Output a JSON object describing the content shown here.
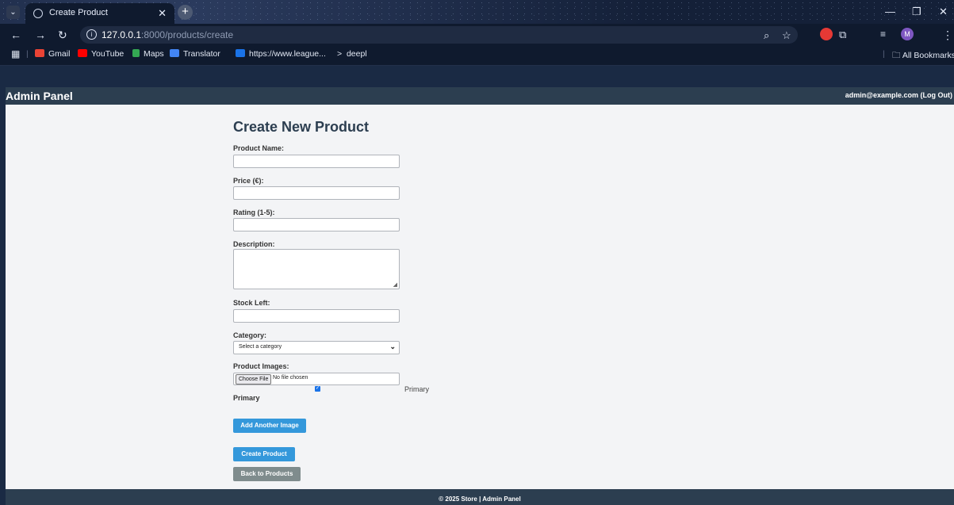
{
  "browser": {
    "tab_title": "Create Product",
    "url_host": "127.0.0.1",
    "url_path": ":8000/products/create",
    "bookmarks": [
      {
        "label": "Gmail",
        "color": "#ea4335"
      },
      {
        "label": "YouTube",
        "color": "#ff0000"
      },
      {
        "label": "Maps",
        "color": "#34a853"
      },
      {
        "label": "Translator",
        "color": "#4285f4"
      },
      {
        "label": "https://www.league...",
        "color": "#1a73e8"
      },
      {
        "label": "deepl",
        "color": "#0f1a2e"
      }
    ],
    "all_bookmarks": "All Bookmarks",
    "profile_initial": "M"
  },
  "header": {
    "brand": "Admin Panel",
    "user": "admin@example.com (Log Out)"
  },
  "form": {
    "title": "Create New Product",
    "product_name_label": "Product Name:",
    "price_label": "Price (€):",
    "rating_label": "Rating (1-5):",
    "description_label": "Description:",
    "stock_label": "Stock Left:",
    "category_label": "Category:",
    "category_selected": "Select a category",
    "images_label": "Product Images:",
    "choose_file": "Choose File",
    "no_file": "No file chosen",
    "primary_right": "Primary",
    "primary_left": "Primary",
    "add_image": "Add Another Image",
    "create": "Create Product",
    "back": "Back to Products"
  },
  "footer": {
    "text": "© 2025 Store | Admin Panel"
  }
}
